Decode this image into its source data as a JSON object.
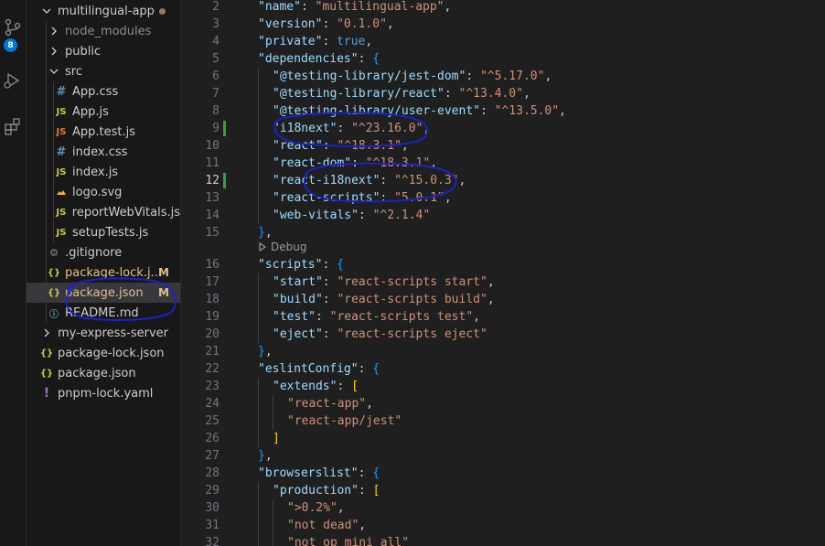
{
  "explorer": {
    "root_label": "multilingual-app",
    "items": [
      {
        "label": "node_modules",
        "type": "folder",
        "muted": true
      },
      {
        "label": "public",
        "type": "folder"
      },
      {
        "label": "src",
        "type": "folder-open"
      },
      {
        "label": "App.css",
        "icon": "#"
      },
      {
        "label": "App.js",
        "icon": "JS"
      },
      {
        "label": "App.test.js",
        "icon": "JS"
      },
      {
        "label": "index.css",
        "icon": "#"
      },
      {
        "label": "index.js",
        "icon": "JS"
      },
      {
        "label": "logo.svg",
        "icon": "img"
      },
      {
        "label": "reportWebVitals.js",
        "icon": "JS"
      },
      {
        "label": "setupTests.js",
        "icon": "JS"
      },
      {
        "label": ".gitignore",
        "icon": "gear"
      },
      {
        "label": "package-lock.j...",
        "icon": "{}",
        "badge": "M"
      },
      {
        "label": "package.json",
        "icon": "{}",
        "badge": "M"
      },
      {
        "label": "README.md",
        "icon": "i"
      },
      {
        "label": "my-express-server",
        "type": "folder"
      },
      {
        "label": "package-lock.json",
        "icon": "{}"
      },
      {
        "label": "package.json",
        "icon": "{}"
      },
      {
        "label": "pnpm-lock.yaml",
        "icon": "!"
      }
    ]
  },
  "activity": {
    "source_control_badge": "8"
  },
  "editor": {
    "codelens_label": "Debug",
    "lines": [
      {
        "n": "2",
        "code": "\"name\": \"multilingual-app\","
      },
      {
        "n": "3",
        "code": "\"version\": \"0.1.0\","
      },
      {
        "n": "4",
        "code": "\"private\": true,"
      },
      {
        "n": "5",
        "code": "\"dependencies\": {"
      },
      {
        "n": "6",
        "code": "\"@testing-library/jest-dom\": \"^5.17.0\","
      },
      {
        "n": "7",
        "code": "\"@testing-library/react\": \"^13.4.0\","
      },
      {
        "n": "8",
        "code": "\"@testing-library/user-event\": \"^13.5.0\","
      },
      {
        "n": "9",
        "code": "\"i18next\": \"^23.16.0\","
      },
      {
        "n": "10",
        "code": "\"react\": \"^18.3.1\","
      },
      {
        "n": "11",
        "code": "\"react-dom\": \"^18.3.1\","
      },
      {
        "n": "12",
        "code": "\"react-i18next\": \"^15.0.3\","
      },
      {
        "n": "13",
        "code": "\"react-scripts\": \"5.0.1\","
      },
      {
        "n": "14",
        "code": "\"web-vitals\": \"^2.1.4\""
      },
      {
        "n": "15",
        "code": "},"
      },
      {
        "n": "16",
        "code": "\"scripts\": {"
      },
      {
        "n": "17",
        "code": "\"start\": \"react-scripts start\","
      },
      {
        "n": "18",
        "code": "\"build\": \"react-scripts build\","
      },
      {
        "n": "19",
        "code": "\"test\": \"react-scripts test\","
      },
      {
        "n": "20",
        "code": "\"eject\": \"react-scripts eject\""
      },
      {
        "n": "21",
        "code": "},"
      },
      {
        "n": "22",
        "code": "\"eslintConfig\": {"
      },
      {
        "n": "23",
        "code": "\"extends\": ["
      },
      {
        "n": "24",
        "code": "\"react-app\","
      },
      {
        "n": "25",
        "code": "\"react-app/jest\""
      },
      {
        "n": "26",
        "code": "]"
      },
      {
        "n": "27",
        "code": "},"
      },
      {
        "n": "28",
        "code": "\"browserslist\": {"
      },
      {
        "n": "29",
        "code": "\"production\": ["
      },
      {
        "n": "30",
        "code": "\">0.2%\","
      },
      {
        "n": "31",
        "code": "\"not dead\","
      },
      {
        "n": "32",
        "code": "\"not op_mini all\""
      }
    ]
  },
  "colors": {
    "annotation": "#1a22c8",
    "git_added": "#2ea043"
  }
}
